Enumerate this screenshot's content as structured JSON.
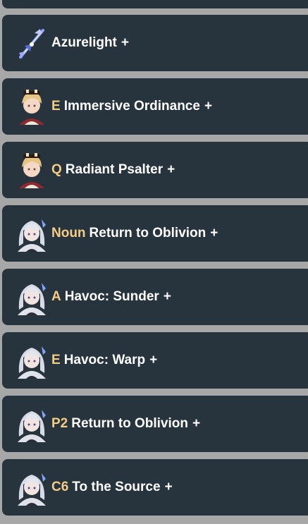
{
  "buffs": [
    {
      "prefix": "",
      "name": "Azurelight",
      "plus": "+",
      "icon": "azurelight-weapon-icon"
    },
    {
      "prefix": "E",
      "name": "Immersive Ordinance",
      "plus": "+",
      "icon": "blonde-character-avatar"
    },
    {
      "prefix": "Q",
      "name": "Radiant Psalter",
      "plus": "+",
      "icon": "blonde-character-avatar"
    },
    {
      "prefix": "Noun",
      "name": "Return to Oblivion",
      "plus": "+",
      "icon": "silver-hair-character-avatar"
    },
    {
      "prefix": "A",
      "name": "Havoc: Sunder",
      "plus": "+",
      "icon": "silver-hair-character-avatar"
    },
    {
      "prefix": "E",
      "name": "Havoc: Warp",
      "plus": "+",
      "icon": "silver-hair-character-avatar"
    },
    {
      "prefix": "P2",
      "name": "Return to Oblivion",
      "plus": "+",
      "icon": "silver-hair-character-avatar"
    },
    {
      "prefix": "C6",
      "name": "To the Source",
      "plus": "+",
      "icon": "silver-hair-character-avatar"
    }
  ],
  "colors": {
    "card_bg": "#27333d",
    "page_bg": "#a7a7a7",
    "prefix": "#f3cd84",
    "text": "#ffffff"
  }
}
